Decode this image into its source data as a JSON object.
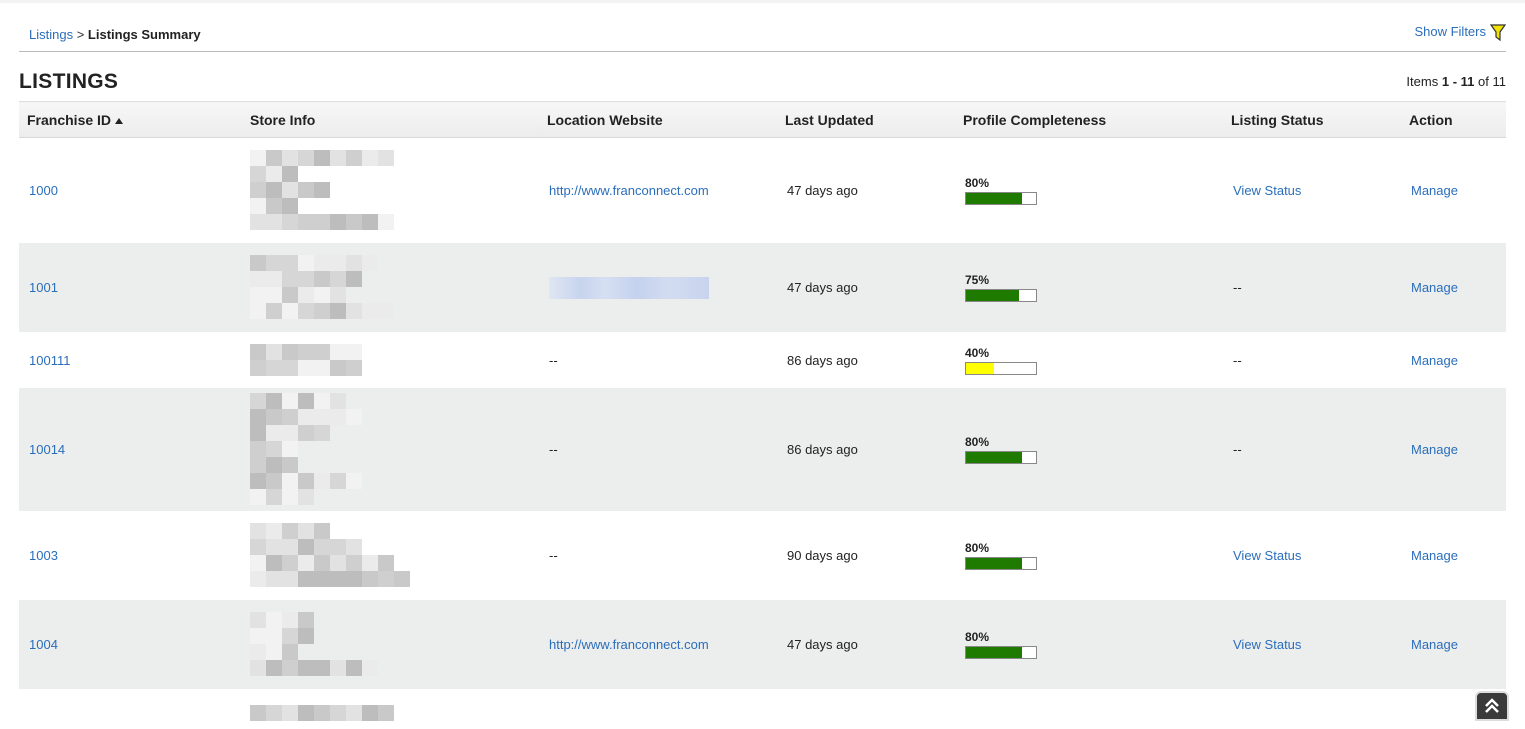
{
  "breadcrumb": {
    "parent": "Listings",
    "separator": ">",
    "current": "Listings Summary"
  },
  "filters": {
    "label": "Show Filters",
    "icon": "funnel-icon"
  },
  "page": {
    "title": "LISTINGS"
  },
  "pagination": {
    "prefix": "Items",
    "from": "1",
    "dash": "-",
    "to": "11",
    "of": "of",
    "total": "11"
  },
  "columns": {
    "franchise_id": "Franchise ID",
    "store_info": "Store Info",
    "location_website": "Location Website",
    "last_updated": "Last Updated",
    "profile_completeness": "Profile Completeness",
    "listing_status": "Listing Status",
    "action": "Action"
  },
  "colors": {
    "link": "#2a6ebb",
    "bar_green": "#1f7a00",
    "bar_yellow": "#ffff00",
    "alt_row": "#eceeed"
  },
  "rows": [
    {
      "franchise_id": "1000",
      "website": "http://www.franconnect.com",
      "website_blurred": false,
      "last_updated": "47 days ago",
      "completeness": "80%",
      "completeness_value": 80,
      "bar_color": "#1f7a00",
      "status": "View Status",
      "status_link": true,
      "action": "Manage"
    },
    {
      "franchise_id": "1001",
      "website": "",
      "website_blurred": true,
      "last_updated": "47 days ago",
      "completeness": "75%",
      "completeness_value": 75,
      "bar_color": "#1f7a00",
      "status": "--",
      "status_link": false,
      "action": "Manage"
    },
    {
      "franchise_id": "100111",
      "website": "--",
      "website_blurred": false,
      "last_updated": "86 days ago",
      "completeness": "40%",
      "completeness_value": 40,
      "bar_color": "#ffff00",
      "status": "--",
      "status_link": false,
      "action": "Manage"
    },
    {
      "franchise_id": "10014",
      "website": "--",
      "website_blurred": false,
      "last_updated": "86 days ago",
      "completeness": "80%",
      "completeness_value": 80,
      "bar_color": "#1f7a00",
      "status": "--",
      "status_link": false,
      "action": "Manage"
    },
    {
      "franchise_id": "1003",
      "website": "--",
      "website_blurred": false,
      "last_updated": "90 days ago",
      "completeness": "80%",
      "completeness_value": 80,
      "bar_color": "#1f7a00",
      "status": "View Status",
      "status_link": true,
      "action": "Manage"
    },
    {
      "franchise_id": "1004",
      "website": "http://www.franconnect.com",
      "website_blurred": false,
      "last_updated": "47 days ago",
      "completeness": "80%",
      "completeness_value": 80,
      "bar_color": "#1f7a00",
      "status": "View Status",
      "status_link": true,
      "action": "Manage"
    }
  ],
  "scroll_top": {
    "icon": "double-chevron-up-icon"
  }
}
